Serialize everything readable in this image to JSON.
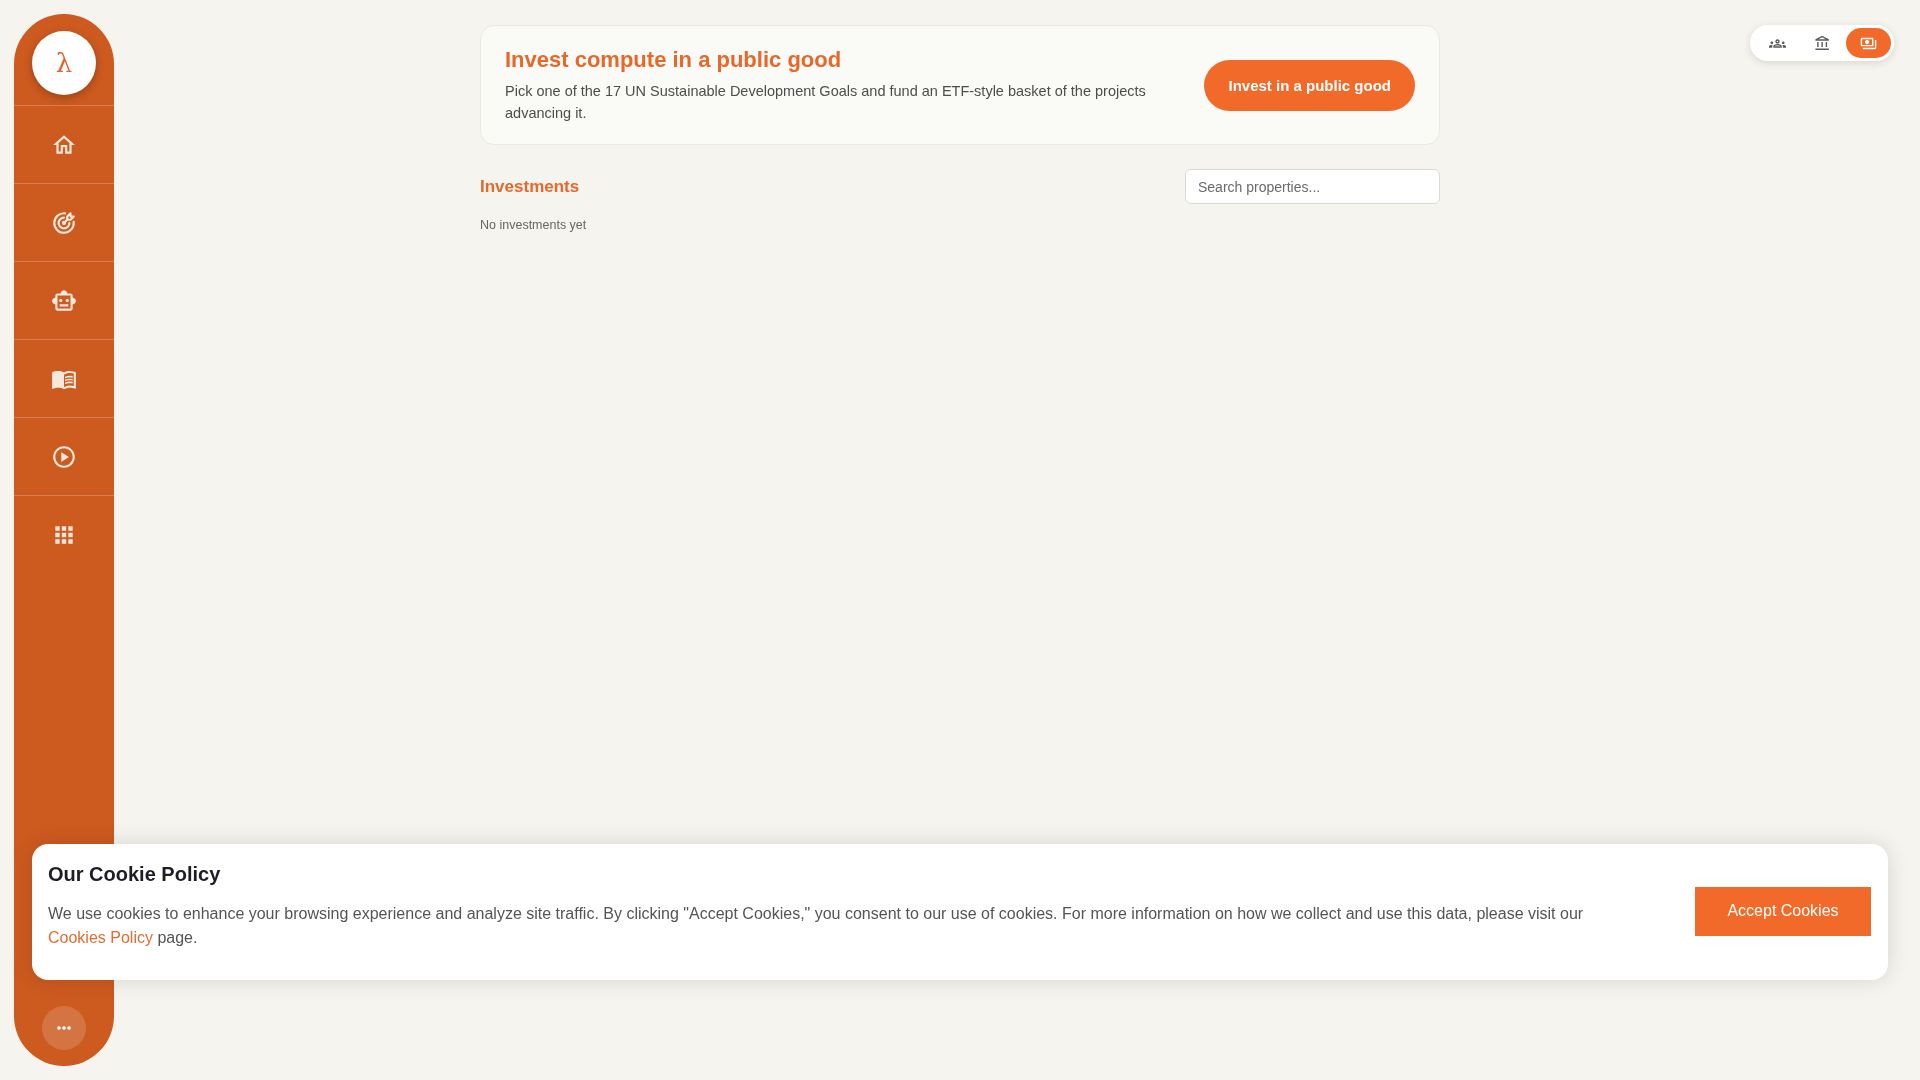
{
  "sidebar": {
    "logo": "λ"
  },
  "view_switcher": {
    "options": [
      {
        "selected": false
      },
      {
        "selected": false
      },
      {
        "selected": true
      }
    ]
  },
  "hero": {
    "title": "Invest compute in a public good",
    "description": "Pick one of the 17 UN Sustainable Development Goals and fund an ETF-style basket of the projects advancing it.",
    "button": "Invest in a public good"
  },
  "investments": {
    "title": "Investments",
    "search": {
      "placeholder": "Search properties..."
    },
    "empty_message": "No investments yet"
  },
  "cookie_banner": {
    "title": "Our Cookie Policy",
    "message": [
      {
        "kind": "text",
        "text": "We use cookies to enhance your browsing experience and analyze site traffic. By clicking \"Accept Cookies,\" you consent to our use of cookies. For more information on how we collect and use this data, please visit our "
      },
      {
        "kind": "link",
        "text": "Cookies Policy"
      },
      {
        "kind": "text",
        "text": " page."
      }
    ],
    "button": "Accept Cookies"
  }
}
